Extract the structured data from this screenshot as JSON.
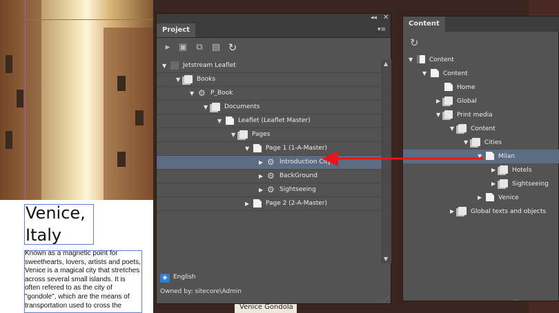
{
  "document": {
    "title": "Venice,\nItaly",
    "body": "Known as a magnetic point for sweethearts, lovers, artists and poets, Venice is a magical city that stretches across several small islands. It is often refered to as the city of \"gondole\", which are the means of transportation used to cross the",
    "bottom_snippet": "Venice Gondola"
  },
  "project_panel": {
    "tab": "Project",
    "collapse_icon": "double-chevron-left-icon",
    "close_icon": "close-icon",
    "menu_icon": "panel-menu-icon",
    "toolbar_icons": [
      "open-document-icon",
      "save-icon",
      "export-icon",
      "checkout-icon",
      "refresh-icon"
    ],
    "tree": [
      {
        "label": "Jetstream Leaflet",
        "icon": "folder-dark-icon",
        "depth": 0,
        "expanded": true
      },
      {
        "label": "Books",
        "icon": "folder-icon",
        "depth": 1,
        "expanded": true
      },
      {
        "label": "P_Book",
        "icon": "book-icon",
        "depth": 2,
        "expanded": true
      },
      {
        "label": "Documents",
        "icon": "folder-icon",
        "depth": 3,
        "expanded": true
      },
      {
        "label": "Leaflet (Leaflet Master)",
        "icon": "document-icon",
        "depth": 4,
        "expanded": true
      },
      {
        "label": "Pages",
        "icon": "folder-icon",
        "depth": 5,
        "expanded": true
      },
      {
        "label": "Page 1 (1-A-Master)",
        "icon": "document-icon",
        "depth": 6,
        "expanded": true
      },
      {
        "label": "Introduction City",
        "icon": "snippet-icon",
        "depth": 7,
        "expanded": false,
        "selected": true
      },
      {
        "label": "BackGround",
        "icon": "snippet-icon",
        "depth": 7,
        "expanded": false
      },
      {
        "label": "Sightseeing",
        "icon": "snippet-icon",
        "depth": 7,
        "expanded": false
      },
      {
        "label": "Page 2 (2-A-Master)",
        "icon": "document-icon",
        "depth": 6,
        "expanded": false
      }
    ],
    "language": "English",
    "owner": "Owned by: sitecore\\Admin"
  },
  "content_panel": {
    "tab": "Content",
    "refresh_icon": "refresh-icon",
    "tree": [
      {
        "label": "Content",
        "icon": "content-root-icon",
        "depth": 0,
        "toggle": "expanded"
      },
      {
        "label": "Content",
        "icon": "document-icon",
        "depth": 1,
        "toggle": "expanded"
      },
      {
        "label": "Home",
        "icon": "document-icon",
        "depth": 2,
        "toggle": "none"
      },
      {
        "label": "Global",
        "icon": "folder-icon",
        "depth": 2,
        "toggle": "collapsed"
      },
      {
        "label": "Print media",
        "icon": "folder-icon",
        "depth": 2,
        "toggle": "expanded"
      },
      {
        "label": "Content",
        "icon": "folder-icon",
        "depth": 3,
        "toggle": "expanded"
      },
      {
        "label": "Cities",
        "icon": "folder-icon",
        "depth": 4,
        "toggle": "expanded"
      },
      {
        "label": "Milan",
        "icon": "document-icon",
        "depth": 5,
        "toggle": "expanded",
        "selected": true
      },
      {
        "label": "Hotels",
        "icon": "folder-icon",
        "depth": 6,
        "toggle": "collapsed"
      },
      {
        "label": "Sightseeing",
        "icon": "folder-icon",
        "depth": 6,
        "toggle": "collapsed"
      },
      {
        "label": "Venice",
        "icon": "document-icon",
        "depth": 5,
        "toggle": "collapsed"
      },
      {
        "label": "Global texts and objects",
        "icon": "folder-icon",
        "depth": 3,
        "toggle": "collapsed"
      }
    ]
  },
  "annotation": {
    "arrow_color": "#e8151b"
  },
  "colors": {
    "panel_bg": "#535353",
    "selection": "#5d6c82",
    "guide": "#9b59d0",
    "frame": "#5b7fd1"
  }
}
